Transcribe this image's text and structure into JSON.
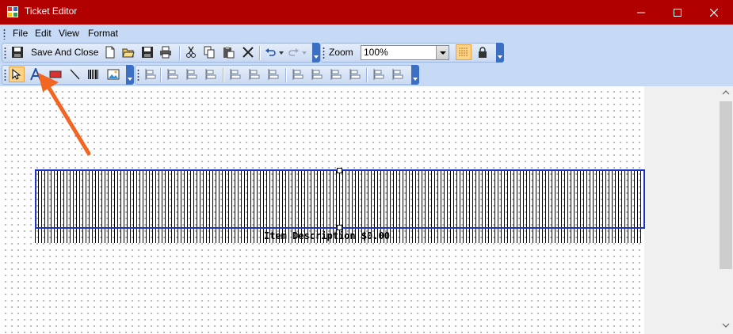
{
  "window": {
    "title": "Ticket Editor",
    "colors": {
      "titlebar": "#b00000",
      "band_border": "#1a33c8",
      "arrow": "#f26522"
    }
  },
  "menu": [
    "File",
    "Edit",
    "View",
    "Format"
  ],
  "toolbar": {
    "save_and_close_label": "Save And Close",
    "zoom_label": "Zoom",
    "zoom_value": "100%"
  },
  "canvas": {
    "item_text": "Item Description $0.00"
  },
  "icons": [
    "save-icon",
    "new-document-icon",
    "open-folder-icon",
    "save-disk-icon",
    "print-icon",
    "cut-icon",
    "copy-icon",
    "paste-icon",
    "delete-icon",
    "undo-icon",
    "redo-icon",
    "grid-icon",
    "lock-icon",
    "pointer-icon",
    "text-icon",
    "rectangle-icon",
    "line-icon",
    "barcode-icon",
    "image-icon"
  ]
}
